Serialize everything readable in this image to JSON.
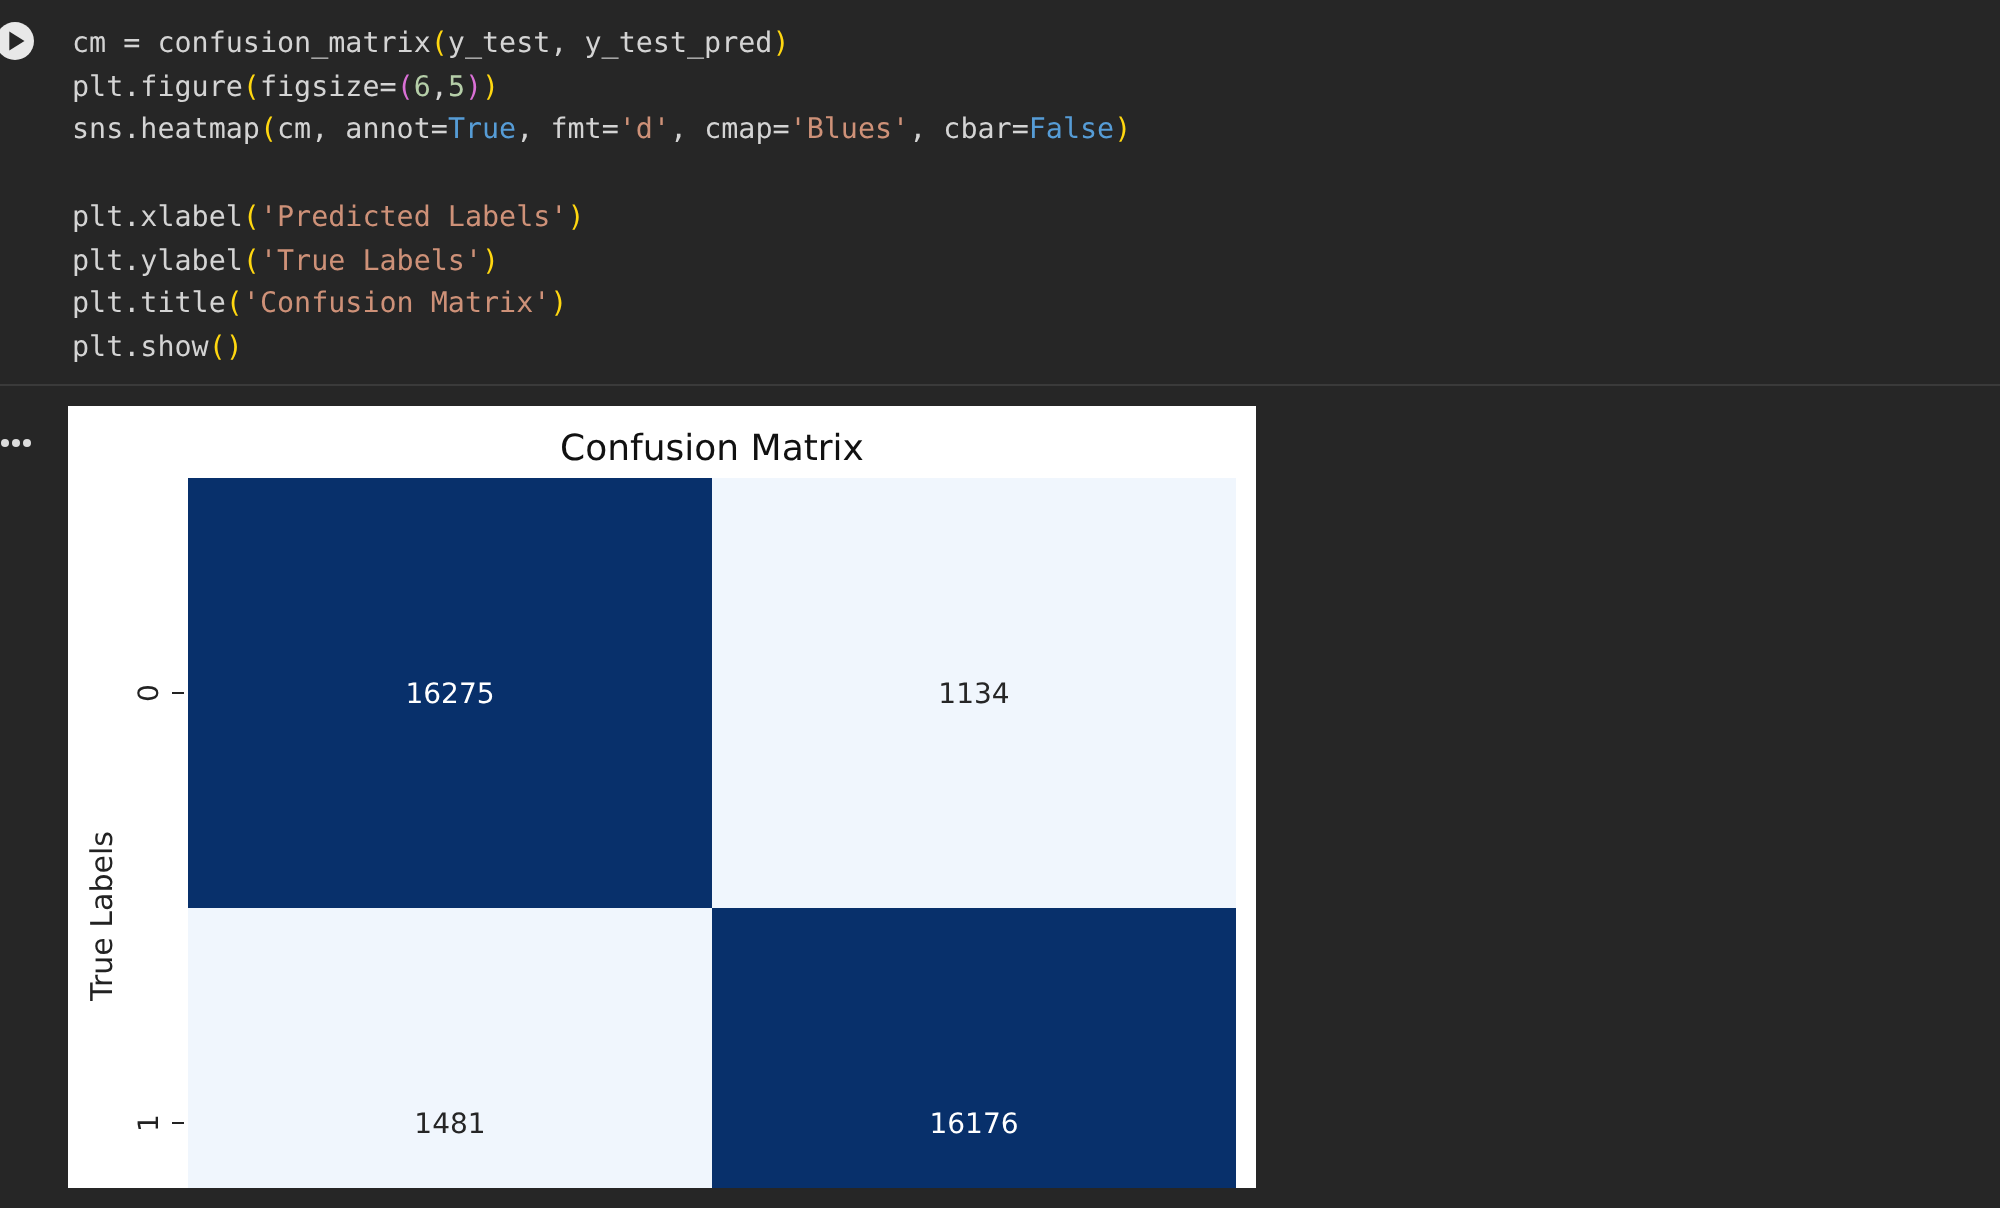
{
  "code_cell": {
    "blocks": [
      [
        [
          {
            "kind": "plain",
            "text": "cm = confusion_matrix"
          },
          {
            "kind": "bracket",
            "text": "("
          },
          {
            "kind": "plain",
            "text": "y_test, y_test_pred"
          },
          {
            "kind": "bracket",
            "text": ")"
          }
        ],
        [
          {
            "kind": "plain",
            "text": "plt.figure"
          },
          {
            "kind": "bracket",
            "text": "("
          },
          {
            "kind": "plain",
            "text": "figsize="
          },
          {
            "kind": "bracket2",
            "text": "("
          },
          {
            "kind": "number",
            "text": "6"
          },
          {
            "kind": "plain",
            "text": ","
          },
          {
            "kind": "number",
            "text": "5"
          },
          {
            "kind": "bracket2",
            "text": ")"
          },
          {
            "kind": "bracket",
            "text": ")"
          }
        ],
        [
          {
            "kind": "plain",
            "text": "sns.heatmap"
          },
          {
            "kind": "bracket",
            "text": "("
          },
          {
            "kind": "plain",
            "text": "cm, annot="
          },
          {
            "kind": "keyword",
            "text": "True"
          },
          {
            "kind": "plain",
            "text": ", fmt="
          },
          {
            "kind": "string",
            "text": "'d'"
          },
          {
            "kind": "plain",
            "text": ", cmap="
          },
          {
            "kind": "string",
            "text": "'Blues'"
          },
          {
            "kind": "plain",
            "text": ", cbar="
          },
          {
            "kind": "keyword",
            "text": "False"
          },
          {
            "kind": "bracket",
            "text": ")"
          }
        ]
      ],
      [
        [
          {
            "kind": "plain",
            "text": "plt.xlabel"
          },
          {
            "kind": "bracket",
            "text": "("
          },
          {
            "kind": "string",
            "text": "'Predicted Labels'"
          },
          {
            "kind": "bracket",
            "text": ")"
          }
        ],
        [
          {
            "kind": "plain",
            "text": "plt.ylabel"
          },
          {
            "kind": "bracket",
            "text": "("
          },
          {
            "kind": "string",
            "text": "'True Labels'"
          },
          {
            "kind": "bracket",
            "text": ")"
          }
        ],
        [
          {
            "kind": "plain",
            "text": "plt.title"
          },
          {
            "kind": "bracket",
            "text": "("
          },
          {
            "kind": "string",
            "text": "'Confusion Matrix'"
          },
          {
            "kind": "bracket",
            "text": ")"
          }
        ],
        [
          {
            "kind": "plain",
            "text": "plt.show"
          },
          {
            "kind": "bracket",
            "text": "()"
          }
        ]
      ]
    ]
  },
  "output": {
    "heatmap": {
      "title": "Confusion Matrix",
      "ylabel": "True Labels",
      "rows": [
        {
          "tick": "0",
          "cells": [
            {
              "value": "16275",
              "color": "#08306b"
            },
            {
              "value": "1134",
              "color": "#f0f6fd"
            }
          ]
        },
        {
          "tick": "1",
          "cells": [
            {
              "value": "1481",
              "color": "#f0f6fd"
            },
            {
              "value": "16176",
              "color": "#08306b"
            }
          ]
        }
      ]
    }
  }
}
